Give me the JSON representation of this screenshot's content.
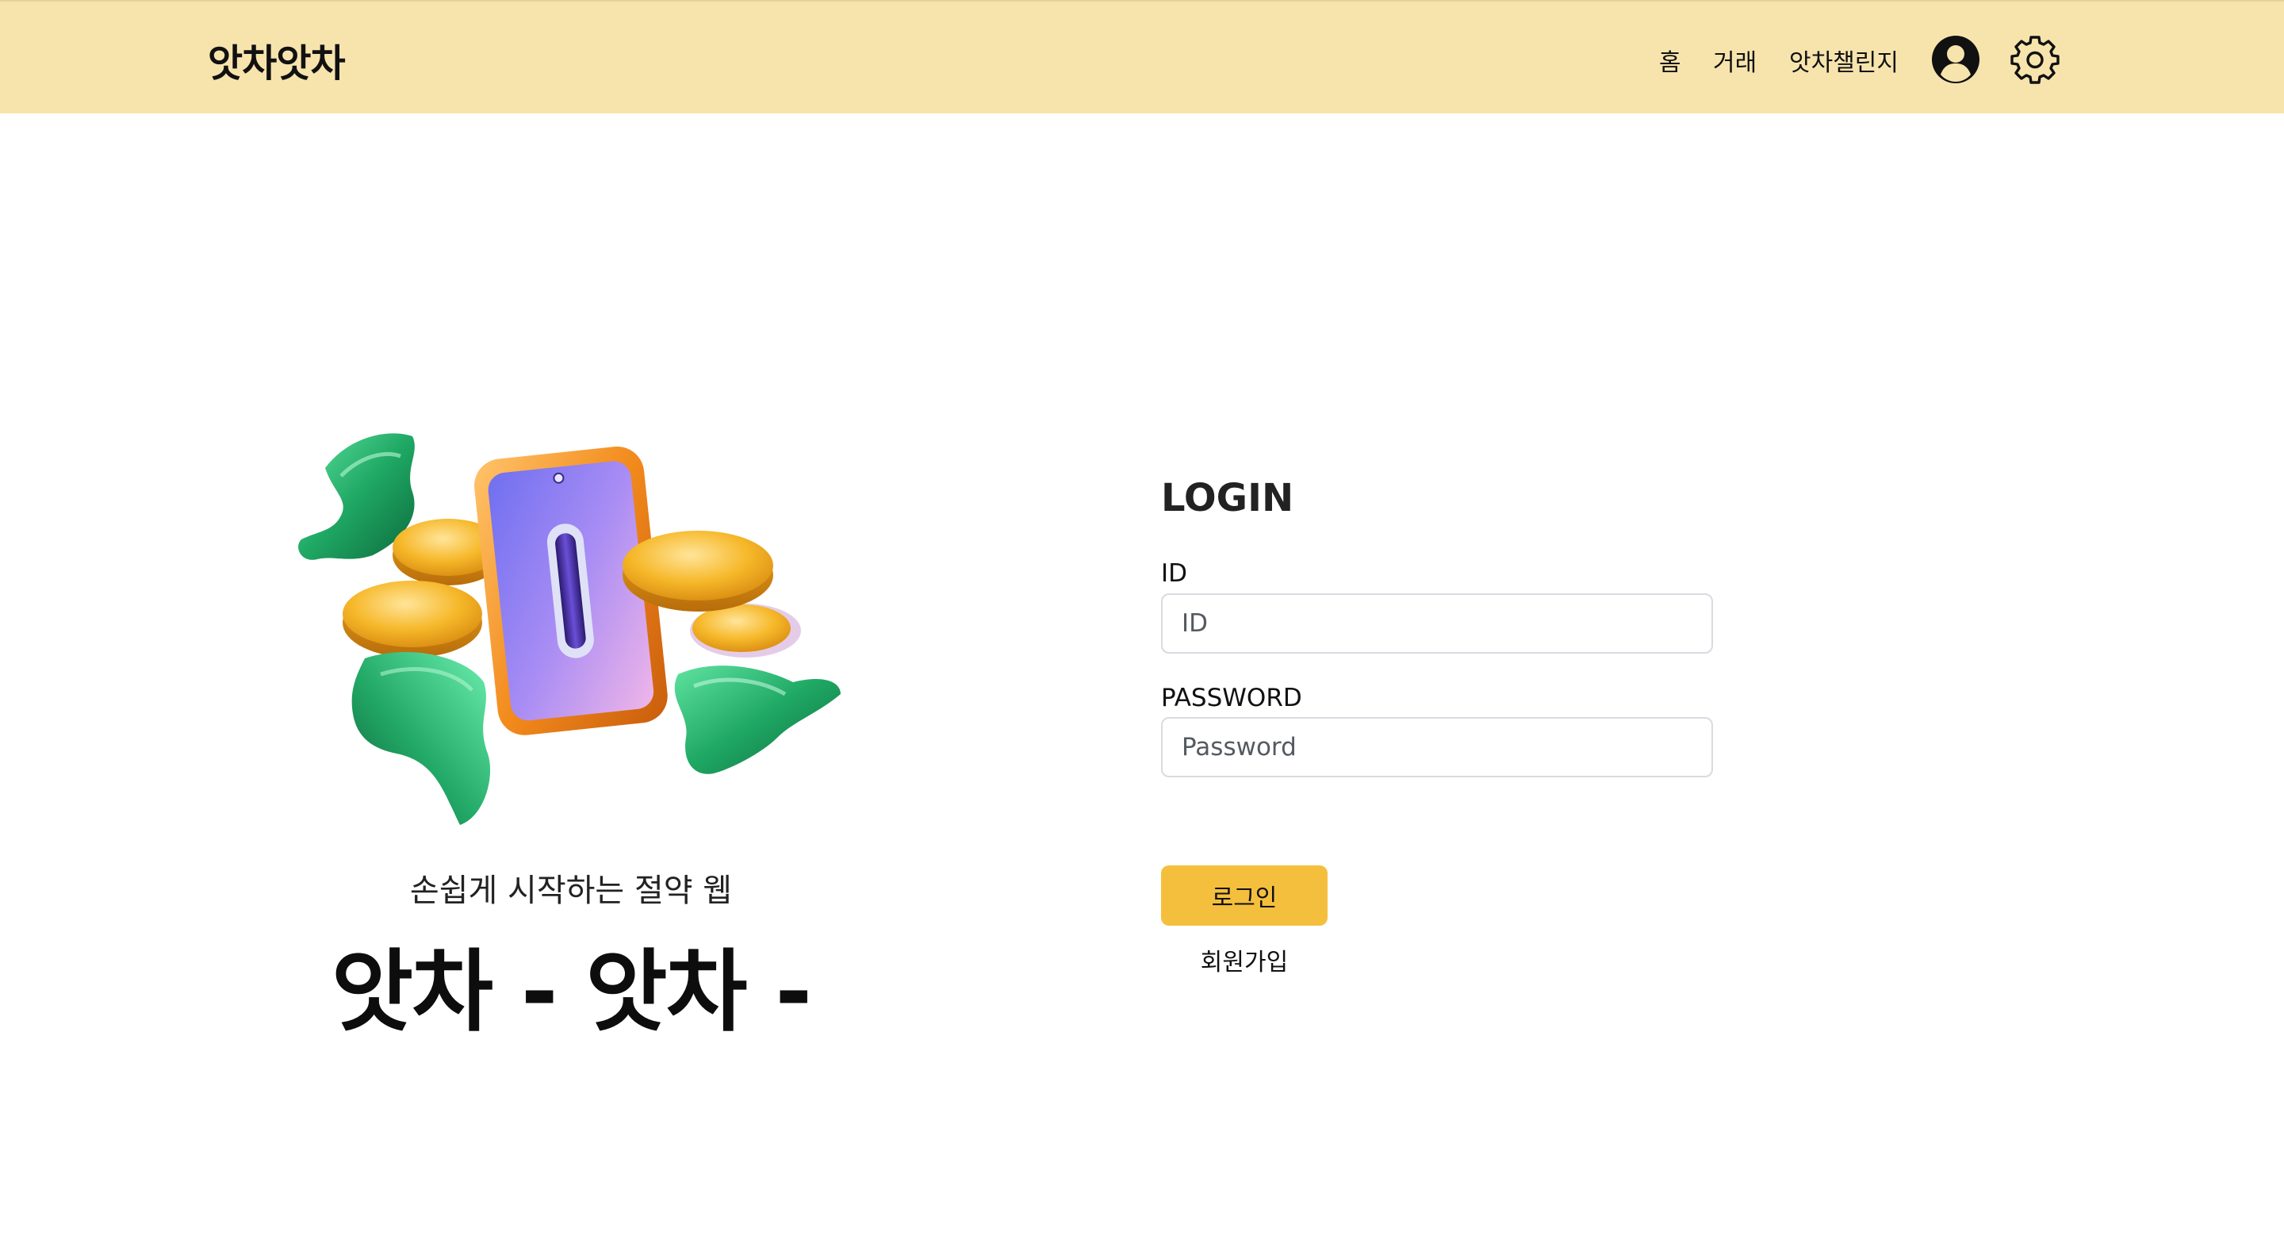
{
  "navbar": {
    "brand": "앗차앗차",
    "links": [
      {
        "label": "홈"
      },
      {
        "label": "거래"
      },
      {
        "label": "앗차챌린지"
      }
    ],
    "icons": [
      "user-circle-icon",
      "gear-icon"
    ],
    "background_color": "#f7e4ad"
  },
  "hero": {
    "illustration": "phone-coins-cash-illustration",
    "tagline": "손쉽게 시작하는 절약 웹",
    "title": "앗차 - 앗차 -"
  },
  "login": {
    "title": "LOGIN",
    "id_label": "ID",
    "id_placeholder": "ID",
    "id_value": "",
    "password_label": "PASSWORD",
    "password_placeholder": "Password",
    "password_value": "",
    "submit_label": "로그인",
    "signup_label": "회원가입",
    "accent_color": "#f5bf3e"
  }
}
